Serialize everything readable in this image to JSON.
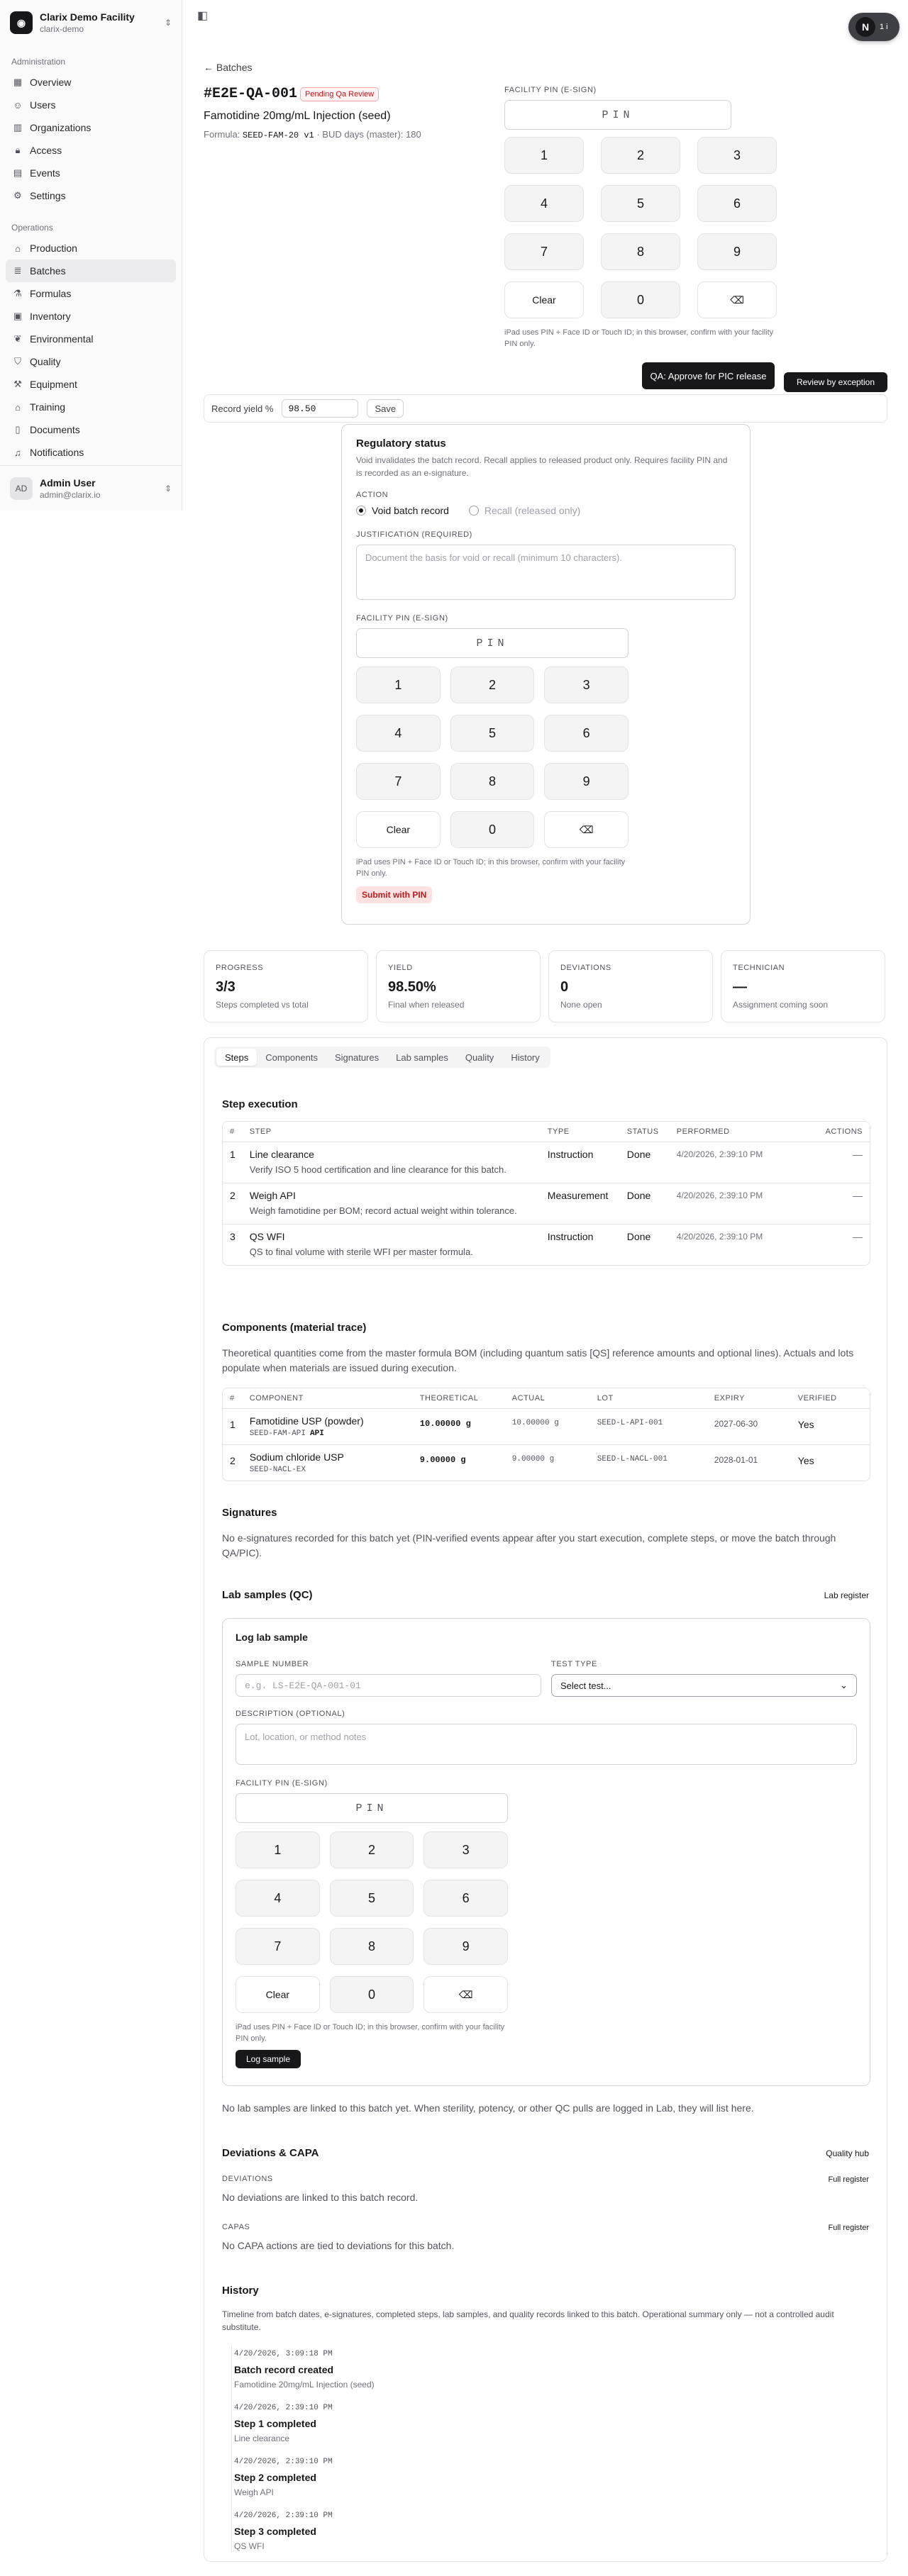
{
  "sidebar": {
    "org_name": "Clarix Demo Facility",
    "org_slug": "clarix-demo",
    "groups": [
      {
        "label": "Administration",
        "items": [
          {
            "label": "Overview",
            "icon": "grid-icon"
          },
          {
            "label": "Users",
            "icon": "users-icon"
          },
          {
            "label": "Organizations",
            "icon": "building-icon"
          },
          {
            "label": "Access",
            "icon": "lock-icon"
          },
          {
            "label": "Events",
            "icon": "calendar-icon"
          },
          {
            "label": "Settings",
            "icon": "gear-icon"
          }
        ]
      },
      {
        "label": "Operations",
        "items": [
          {
            "label": "Production",
            "icon": "factory-icon"
          },
          {
            "label": "Batches",
            "icon": "layers-icon",
            "active": true
          },
          {
            "label": "Formulas",
            "icon": "flask-icon"
          },
          {
            "label": "Inventory",
            "icon": "box-icon"
          },
          {
            "label": "Environmental",
            "icon": "leaf-icon"
          },
          {
            "label": "Quality",
            "icon": "shield-icon"
          },
          {
            "label": "Equipment",
            "icon": "wrench-icon"
          },
          {
            "label": "Training",
            "icon": "graduation-cap-icon"
          },
          {
            "label": "Documents",
            "icon": "document-icon"
          },
          {
            "label": "Notifications",
            "icon": "bell-icon"
          }
        ]
      }
    ],
    "user": {
      "initials": "AD",
      "name": "Admin User",
      "email": "admin@clarix.io"
    }
  },
  "dev_pill": {
    "letter": "N",
    "extra": "1 i"
  },
  "header": {
    "back_label": "Batches",
    "batch_id": "#E2E-QA-001",
    "status_badge": "Pending Qa Review",
    "product": "Famotidine 20mg/mL Injection (seed)",
    "formula_prefix": "Formula:",
    "formula_code": "SEED-FAM-20 v1",
    "bud_text": " · BUD days (master): 180"
  },
  "pin": {
    "label": "FACILITY PIN (E-SIGN)",
    "placeholder": "PIN",
    "keys": [
      "1",
      "2",
      "3",
      "4",
      "5",
      "6",
      "7",
      "8",
      "9",
      "Clear",
      "0",
      "⌫"
    ],
    "note": "iPad uses PIN + Face ID or Touch ID; in this browser, confirm with your facility PIN only."
  },
  "actions": {
    "approve": "QA: Approve for PIC release",
    "exception": "Review by exception"
  },
  "yield_row": {
    "label": "Record yield %",
    "value": "98.50",
    "save": "Save"
  },
  "regulatory": {
    "title": "Regulatory status",
    "desc": "Void invalidates the batch record. Recall applies to released product only. Requires facility PIN and is recorded as an e-signature.",
    "action_label": "ACTION",
    "void_label": "Void batch record",
    "recall_label": "Recall (released only)",
    "justification_label": "JUSTIFICATION (REQUIRED)",
    "justification_placeholder": "Document the basis for void or recall (minimum 10 characters).",
    "submit": "Submit with PIN"
  },
  "stats": [
    {
      "key": "PROGRESS",
      "value": "3/3",
      "sub": "Steps completed vs total"
    },
    {
      "key": "YIELD",
      "value": "98.50%",
      "sub": "Final when released"
    },
    {
      "key": "DEVIATIONS",
      "value": "0",
      "sub": "None open"
    },
    {
      "key": "TECHNICIAN",
      "value": "—",
      "sub": "Assignment coming soon"
    }
  ],
  "tabs": [
    "Steps",
    "Components",
    "Signatures",
    "Lab samples",
    "Quality",
    "History"
  ],
  "steps": {
    "title": "Step execution",
    "headers": [
      "#",
      "STEP",
      "TYPE",
      "STATUS",
      "PERFORMED",
      "ACTIONS"
    ],
    "rows": [
      {
        "n": "1",
        "name": "Line clearance",
        "desc": "Verify ISO 5 hood certification and line clearance for this batch.",
        "type": "Instruction",
        "status": "Done",
        "performed": "4/20/2026, 2:39:10 PM",
        "action": "—"
      },
      {
        "n": "2",
        "name": "Weigh API",
        "desc": "Weigh famotidine per BOM; record actual weight within tolerance.",
        "type": "Measurement",
        "status": "Done",
        "performed": "4/20/2026, 2:39:10 PM",
        "action": "—"
      },
      {
        "n": "3",
        "name": "QS WFI",
        "desc": "QS to final volume with sterile WFI per master formula.",
        "type": "Instruction",
        "status": "Done",
        "performed": "4/20/2026, 2:39:10 PM",
        "action": "—"
      }
    ]
  },
  "components": {
    "title": "Components (material trace)",
    "desc": "Theoretical quantities come from the master formula BOM (including quantum satis [QS] reference amounts and optional lines). Actuals and lots populate when materials are issued during execution.",
    "headers": [
      "#",
      "COMPONENT",
      "THEORETICAL",
      "ACTUAL",
      "LOT",
      "EXPIRY",
      "VERIFIED"
    ],
    "rows": [
      {
        "n": "1",
        "name": "Famotidine USP (powder)",
        "code": "SEED-FAM-API",
        "tag": "API",
        "theoretical": "10.00000 g",
        "actual": "10.00000 g",
        "lot": "SEED-L-API-001",
        "expiry": "2027-06-30",
        "verified": "Yes"
      },
      {
        "n": "2",
        "name": "Sodium chloride USP",
        "code": "SEED-NACL-EX",
        "tag": "",
        "theoretical": "9.00000 g",
        "actual": "9.00000 g",
        "lot": "SEED-L-NACL-001",
        "expiry": "2028-01-01",
        "verified": "Yes"
      }
    ]
  },
  "signatures": {
    "title": "Signatures",
    "desc": "No e-signatures recorded for this batch yet (PIN-verified events appear after you start execution, complete steps, or move the batch through QA/PIC)."
  },
  "lab": {
    "title": "Lab samples (QC)",
    "link": "Lab register",
    "card_title": "Log lab sample",
    "sample_label": "SAMPLE NUMBER",
    "sample_placeholder": "e.g. LS-E2E-QA-001-01",
    "test_label": "TEST TYPE",
    "test_value": "Select test...",
    "desc_label": "DESCRIPTION (OPTIONAL)",
    "desc_placeholder": "Lot, location, or method notes",
    "submit": "Log sample",
    "empty": "No lab samples are linked to this batch yet. When sterility, potency, or other QC pulls are logged in Lab, they will list here."
  },
  "quality": {
    "title": "Deviations & CAPA",
    "link": "Quality hub",
    "dev_label": "DEVIATIONS",
    "dev_link": "Full register",
    "dev_empty": "No deviations are linked to this batch record.",
    "capa_label": "CAPAS",
    "capa_link": "Full register",
    "capa_empty": "No CAPA actions are tied to deviations for this batch."
  },
  "history": {
    "title": "History",
    "desc": "Timeline from batch dates, e-signatures, completed steps, lab samples, and quality records linked to this batch. Operational summary only — not a controlled audit substitute.",
    "items": [
      {
        "ts": "4/20/2026, 3:09:18 PM",
        "title": "Batch record created",
        "detail": "Famotidine 20mg/mL Injection (seed)"
      },
      {
        "ts": "4/20/2026, 2:39:10 PM",
        "title": "Step 1 completed",
        "detail": "Line clearance"
      },
      {
        "ts": "4/20/2026, 2:39:10 PM",
        "title": "Step 2 completed",
        "detail": "Weigh API"
      },
      {
        "ts": "4/20/2026, 2:39:10 PM",
        "title": "Step 3 completed",
        "detail": "QS WFI"
      }
    ]
  }
}
